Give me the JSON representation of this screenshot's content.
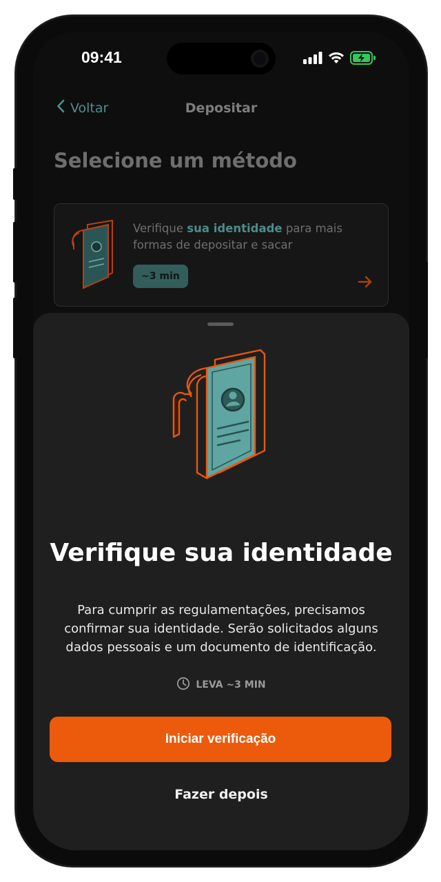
{
  "status_bar": {
    "time": "09:41",
    "icons": [
      "signal-icon",
      "wifi-icon",
      "battery-charging-icon"
    ],
    "battery_color": "#34c759"
  },
  "nav": {
    "back_label": "Voltar",
    "title": "Depositar"
  },
  "page": {
    "section_title": "Selecione um método",
    "method_card": {
      "text_prefix": "Verifique ",
      "text_highlight": "sua identidade",
      "text_suffix": " para mais formas de depositar e sacar",
      "chip": "~3 min"
    }
  },
  "sheet": {
    "title": "Verifique sua identidade",
    "description": "Para cumprir as regulamentações, precisamos confirmar sua identidade. Serão solicitados alguns dados pessoais e um documento de identificação.",
    "duration_label": "LEVA ~3 MIN",
    "primary_button": "Iniciar verificação",
    "secondary_button": "Fazer depois"
  },
  "colors": {
    "accent_orange": "#ec5a0b",
    "accent_teal": "#4b8d89",
    "sheet_background": "#1f1f20",
    "page_background": "#0e0e0f"
  }
}
